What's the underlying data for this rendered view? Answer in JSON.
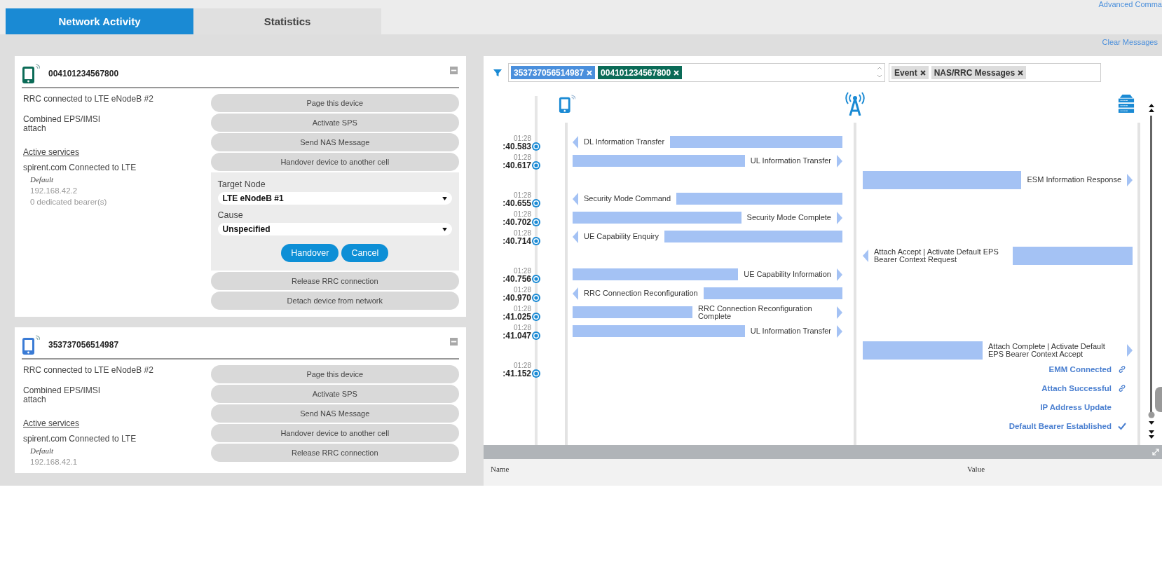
{
  "header": {
    "tabs": [
      {
        "label": "Network Activity",
        "selected": true
      },
      {
        "label": "Statistics",
        "selected": false
      }
    ],
    "link": "Advanced Comma"
  },
  "devices": [
    {
      "id": "004101234567800",
      "color": "#0b6b57",
      "status": "RRC connected to LTE eNodeB #2",
      "attach": "Combined EPS/IMSI attach",
      "services_title": "Active services",
      "services": [
        {
          "apn": "spirent.com Connected to LTE",
          "bearer": "Default",
          "ip": "192.168.42.2",
          "dedicated": "0 dedicated bearer(s)"
        }
      ],
      "actions": [
        {
          "label": "Page this device"
        },
        {
          "label": "Activate SPS"
        },
        {
          "label": "Send NAS Message"
        },
        {
          "label": "Handover device to another cell",
          "form": {
            "fields": [
              {
                "label": "Target Node",
                "value": "LTE eNodeB #1"
              },
              {
                "label": "Cause",
                "value": "Unspecified"
              }
            ],
            "buttons": [
              "Handover",
              "Cancel"
            ]
          }
        },
        {
          "label": "Release RRC connection"
        },
        {
          "label": "Detach device from network"
        }
      ]
    },
    {
      "id": "353737056514987",
      "color": "#3a7bd5",
      "status": "RRC connected to LTE eNodeB #2",
      "attach": "Combined EPS/IMSI attach",
      "services_title": "Active services",
      "services": [
        {
          "apn": "spirent.com Connected to LTE",
          "bearer": "Default",
          "ip": "192.168.42.1"
        }
      ],
      "actions": [
        {
          "label": "Page this device"
        },
        {
          "label": "Activate SPS"
        },
        {
          "label": "Send NAS Message"
        },
        {
          "label": "Handover device to another cell"
        },
        {
          "label": "Release RRC connection"
        }
      ]
    }
  ],
  "messages_panel": {
    "clear": "Clear Messages",
    "device_filters": [
      {
        "label": "353737056514987",
        "color": "#4a8fdc"
      },
      {
        "label": "004101234567800",
        "color": "#0b6b57"
      }
    ],
    "type_filters": [
      {
        "label": "Event"
      },
      {
        "label": "NAS/RRC Messages"
      }
    ],
    "rows": [
      {
        "kind": "downlink",
        "minute": "01:28",
        "time": ":40.583",
        "label": "DL Information Transfer"
      },
      {
        "kind": "uplink",
        "minute": "01:28",
        "time": ":40.617",
        "label": "UL Information Transfer"
      },
      {
        "kind": "coreuplink",
        "label": "ESM Information Response"
      },
      {
        "kind": "downlink",
        "minute": "01:28",
        "time": ":40.655",
        "label": "Security Mode Command"
      },
      {
        "kind": "uplink",
        "minute": "01:28",
        "time": ":40.702",
        "label": "Security Mode Complete"
      },
      {
        "kind": "downlink",
        "minute": "01:28",
        "time": ":40.714",
        "label": "UE Capability Enquiry"
      },
      {
        "kind": "coredownlink",
        "label": "Attach Accept | Activate Default EPS Bearer Context Request"
      },
      {
        "kind": "uplink",
        "minute": "01:28",
        "time": ":40.756",
        "label": "UE Capability Information"
      },
      {
        "kind": "downlink",
        "minute": "01:28",
        "time": ":40.970",
        "label": "RRC Connection Reconfiguration"
      },
      {
        "kind": "uplink",
        "minute": "01:28",
        "time": ":41.025",
        "label": "RRC Connection Reconfiguration Complete"
      },
      {
        "kind": "uplink",
        "minute": "01:28",
        "time": ":41.047",
        "label": "UL Information Transfer"
      },
      {
        "kind": "coreuplink",
        "label": "Attach Complete | Activate Default EPS Bearer Context Accept"
      },
      {
        "kind": "linkevent",
        "minute": "01:28",
        "time": ":41.152",
        "label": "EMM Connected"
      },
      {
        "kind": "linkevent",
        "label": "Attach Successful"
      },
      {
        "kind": "event",
        "label": "IP Address Update"
      },
      {
        "kind": "checkevent",
        "label": "Default Bearer Established"
      }
    ],
    "details_columns": [
      "Name",
      "Value"
    ]
  }
}
